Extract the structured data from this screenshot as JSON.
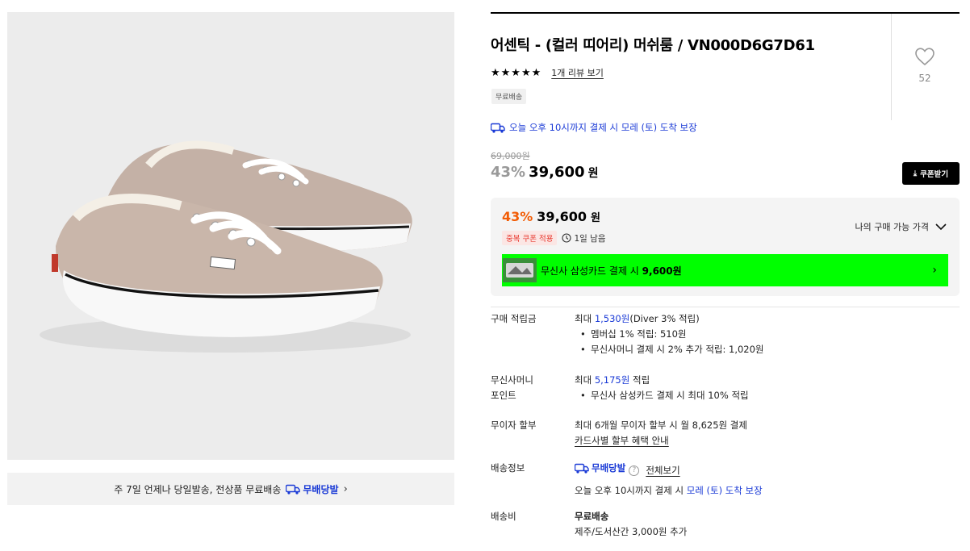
{
  "product": {
    "title": "어센틱 - (컬러 띠어리) 머쉬룸 / VN000D6G7D61",
    "stars": "★★★★★",
    "review_link": "1개 리뷰 보기",
    "free_tag": "무료배송",
    "likes": "52"
  },
  "left": {
    "ship_banner_text": "주 7일 언제나 당일발송, 전상품 무료배송",
    "brand_badge": "무배당발",
    "chevron": "›"
  },
  "arrival": "오늘 오후 10시까지 결제 시 모레 (토) 도착 보장",
  "price": {
    "original": "69,000원",
    "discount_pct": "43%",
    "value": "39,600",
    "won": "원",
    "coupon_button": "쿠폰받기"
  },
  "deal": {
    "discount_pct": "43%",
    "value": "39,600",
    "won": "원",
    "dup_badge": "중복 쿠폰 적용",
    "time_left": "1일 남음",
    "my_price": "나의 구매 가능 가격",
    "card_text_prefix": "무신사 삼성카드 결제 시 ",
    "card_text_amount": "9,600원",
    "bar_color": "#00ff00",
    "discount_color": "#f25c05"
  },
  "info": {
    "points": {
      "label": "구매 적립금",
      "line_prefix": "최대 ",
      "line_amount": "1,530원",
      "line_suffix": "(Diver 3% 적립)",
      "bullets": [
        "멤버십 1% 적립: 510원",
        "무신사머니 결제 시 2% 추가 적립: 1,020원"
      ]
    },
    "money": {
      "label_1": "무신사머니",
      "label_2": "포인트",
      "line_prefix": "최대 ",
      "line_amount": "5,175원",
      "line_suffix": " 적립",
      "bullets": [
        "무신사 삼성카드 결제 시 최대 10% 적립"
      ]
    },
    "installment": {
      "label": "무이자 할부",
      "line": "최대 6개월 무이자 할부 시 월 8,625원 결제",
      "link": "카드사별 할부 혜택 안내"
    },
    "shipping_info": {
      "label": "배송정보",
      "badge": "무배당발",
      "help": "?",
      "view_all": "전체보기",
      "line_prefix": "오늘 오후 10시까지 결제 시 ",
      "line_blue": "모레 (토) 도착 보장"
    },
    "shipping_fee": {
      "label": "배송비",
      "line_1": "무료배송",
      "line_2": "제주/도서산간 3,000원 추가"
    }
  },
  "colors": {
    "accent_blue": "#1a3ad6",
    "discount_orange": "#f25c05",
    "coupon_red": "#e8352b"
  }
}
